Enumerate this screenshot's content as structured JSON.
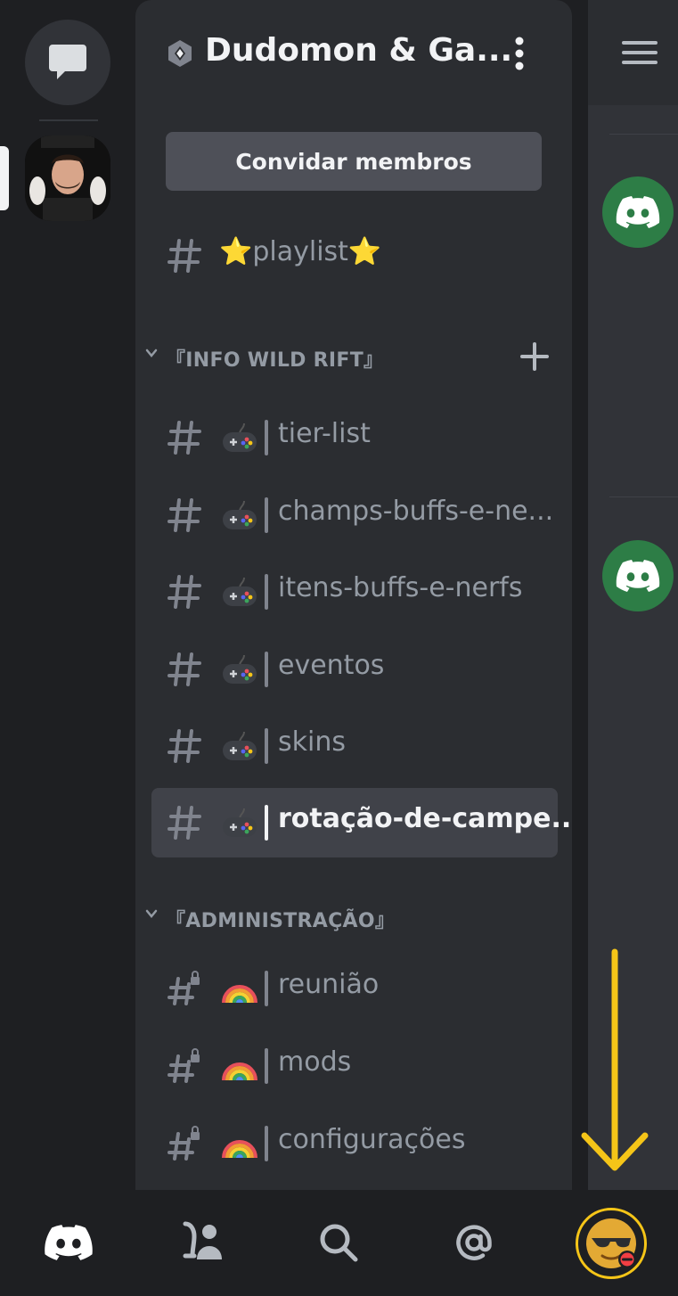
{
  "server": {
    "name": "Dudomon & Ga...",
    "invite_label": "Convidar membros"
  },
  "channels_top": [
    {
      "name": "⭐playlist⭐"
    }
  ],
  "categories": [
    {
      "label": "『INFO WILD RIFT』",
      "channels": [
        {
          "name": "tier-list",
          "selected": false
        },
        {
          "name": "champs-buffs-e-ne...",
          "selected": false
        },
        {
          "name": "itens-buffs-e-nerfs",
          "selected": false
        },
        {
          "name": "eventos",
          "selected": false
        },
        {
          "name": "skins",
          "selected": false
        },
        {
          "name": "rotação-de-campe...",
          "selected": true
        }
      ]
    },
    {
      "label": "『ADMINISTRAÇÃO』",
      "channels": [
        {
          "name": "reunião",
          "locked": true
        },
        {
          "name": "mods",
          "locked": true
        },
        {
          "name": "configurações",
          "locked": true
        }
      ]
    }
  ],
  "icons": {
    "channel_emoji_info": "gamepad-icon",
    "channel_emoji_admin": "rainbow-icon"
  },
  "colors": {
    "panel_bg": "#2b2d31",
    "rail_bg": "#1e1f22",
    "selected_bg": "#404249",
    "muted_text": "#949ba4",
    "highlight_arrow": "#f5c518",
    "bot_avatar": "#2d7d46"
  }
}
